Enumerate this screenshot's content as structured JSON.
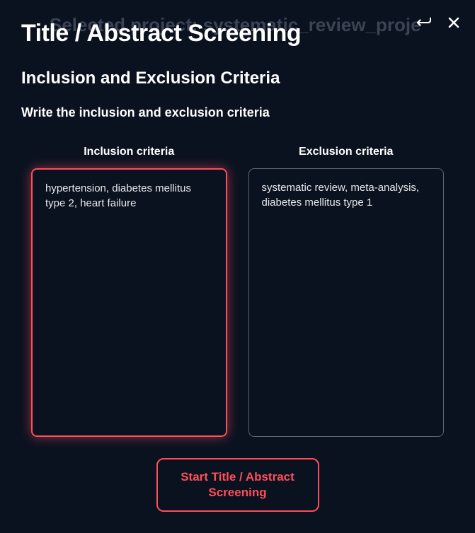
{
  "backdrop": {
    "project_text": "Selected project: systematic_review_proje"
  },
  "modal": {
    "title": "Title / Abstract Screening",
    "section_title": "Inclusion and Exclusion Criteria",
    "instruction": "Write the inclusion and exclusion criteria",
    "inclusion": {
      "label": "Inclusion criteria",
      "value": "hypertension, diabetes mellitus type 2, heart failure"
    },
    "exclusion": {
      "label": "Exclusion criteria",
      "value": "systematic review, meta-analysis, diabetes mellitus type 1"
    },
    "start_button": "Start Title / Abstract Screening"
  }
}
